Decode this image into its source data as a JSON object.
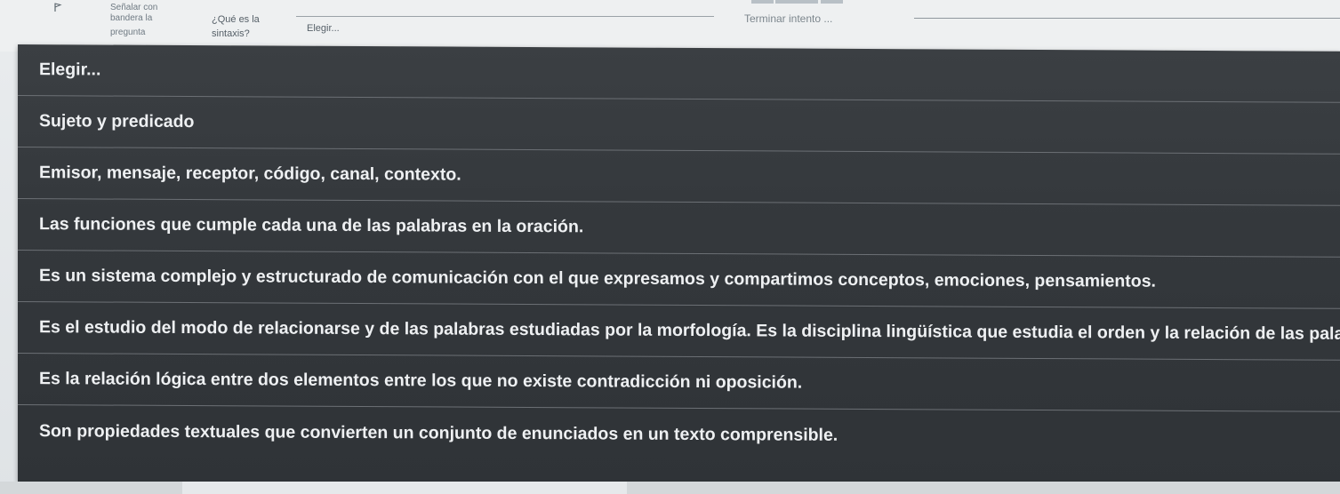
{
  "question": {
    "flag_line1": "Señalar con",
    "flag_line2": "bandera la",
    "flag_line3": "pregunta",
    "prompt_line1": "¿Qué es la",
    "prompt_line2": "sintaxis?",
    "select_value": "Elegir...",
    "finish_link": "Terminar intento ..."
  },
  "dropdown": {
    "options": [
      "Elegir...",
      "Sujeto y predicado",
      "Emisor, mensaje, receptor, código, canal, contexto.",
      "Las funciones que cumple cada una de las palabras en la oración.",
      "Es un sistema complejo y estructurado de comunicación con el que expresamos y compartimos conceptos, emociones, pensamientos.",
      "Es el estudio del modo de relacionarse y de las palabras estudiadas por la morfología. Es la disciplina lingüística que estudia el orden y la relación de las palab...",
      "Es la relación lógica entre dos elementos entre los que no existe contradicción ni oposición.",
      "Son propiedades textuales que convierten un conjunto de enunciados en un texto comprensible."
    ]
  },
  "icons": {
    "flag": "flag-icon"
  }
}
